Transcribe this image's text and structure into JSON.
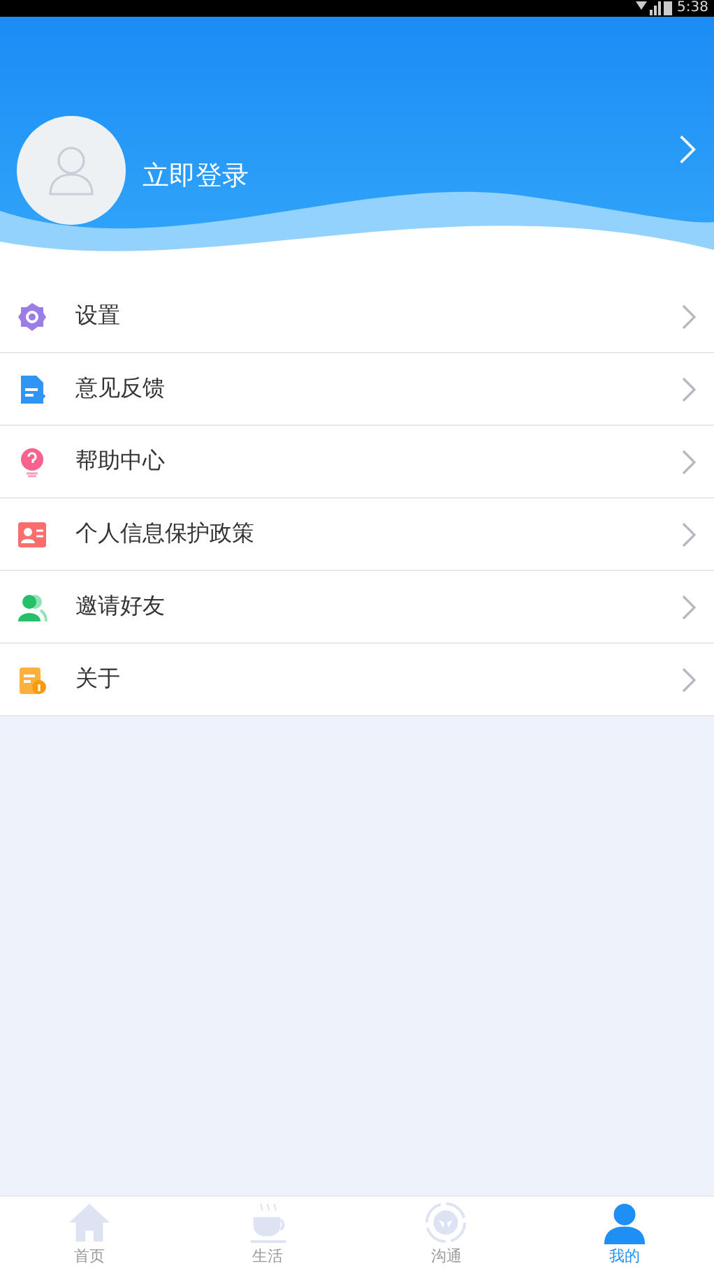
{
  "status_bar": {
    "time": "5:38"
  },
  "profile": {
    "login_label": "立即登录"
  },
  "menu": [
    {
      "kind": "settings",
      "label": "设置"
    },
    {
      "kind": "feedback",
      "label": "意见反馈"
    },
    {
      "kind": "help",
      "label": "帮助中心"
    },
    {
      "kind": "privacy",
      "label": "个人信息保护政策"
    },
    {
      "kind": "invite",
      "label": "邀请好友"
    },
    {
      "kind": "about",
      "label": "关于"
    }
  ],
  "tabs": [
    {
      "kind": "home",
      "label": "首页",
      "selected": false
    },
    {
      "kind": "life",
      "label": "生活",
      "selected": false
    },
    {
      "kind": "chat",
      "label": "沟通",
      "selected": false
    },
    {
      "kind": "mine",
      "label": "我的",
      "selected": true
    }
  ]
}
